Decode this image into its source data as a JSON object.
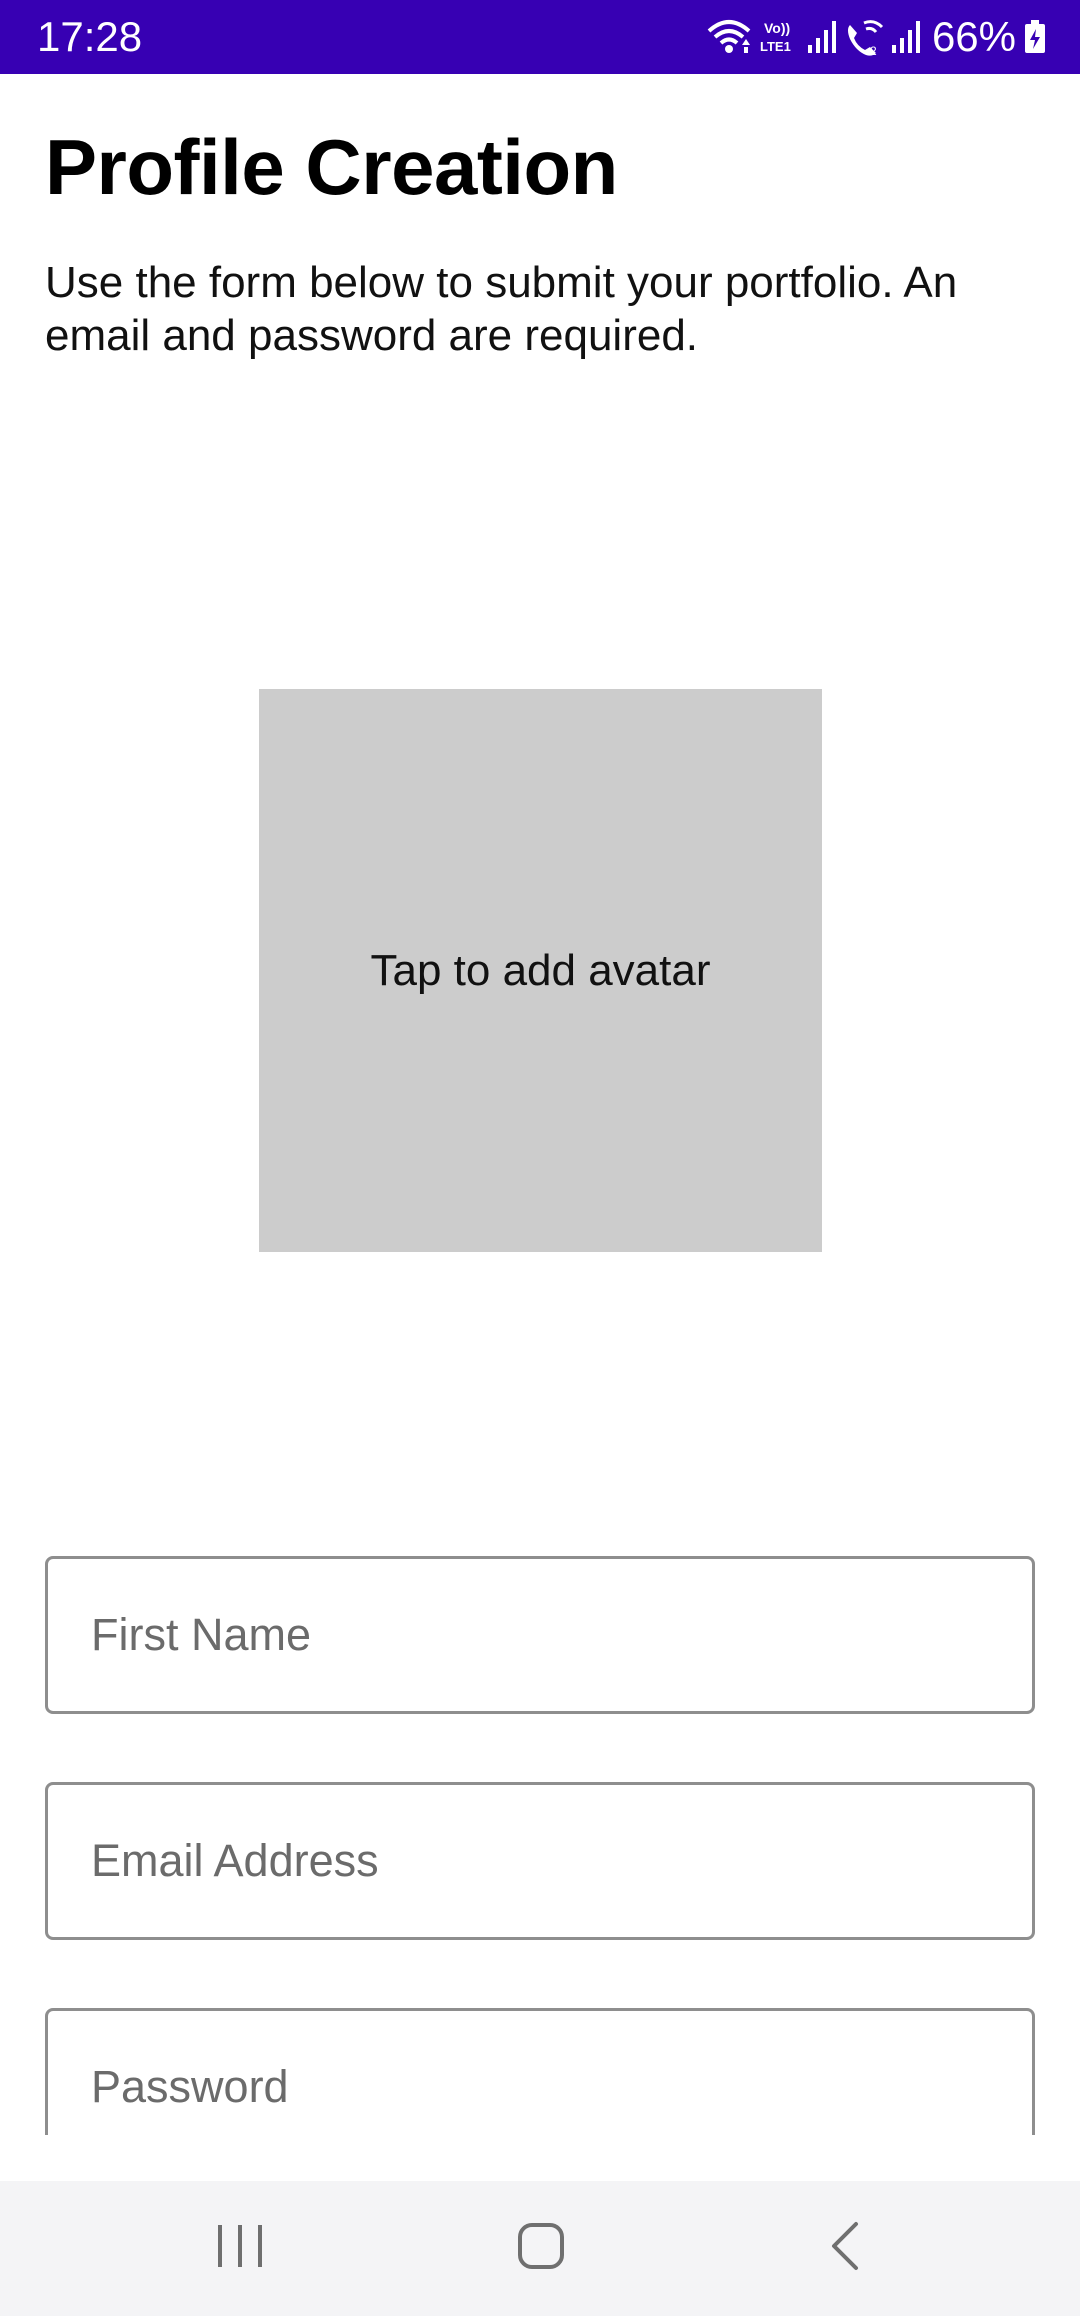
{
  "status_bar": {
    "time": "17:28",
    "battery_percent": "66%",
    "background_color": "#3700b3",
    "icons": [
      "wifi-icon",
      "volte-icon",
      "signal-icon",
      "wifi-calling-icon",
      "signal-icon",
      "battery-charging-icon"
    ]
  },
  "page": {
    "title": "Profile Creation",
    "description": "Use the form below to submit your portfolio. An email and password are required."
  },
  "avatar": {
    "label": "Tap to add avatar",
    "background_color": "#cccccc"
  },
  "form": {
    "first_name": {
      "placeholder": "First Name",
      "value": ""
    },
    "email": {
      "placeholder": "Email Address",
      "value": ""
    },
    "password": {
      "placeholder": "Password",
      "value": ""
    }
  },
  "nav_bar": {
    "buttons": [
      "recents-icon",
      "home-icon",
      "back-icon"
    ]
  }
}
